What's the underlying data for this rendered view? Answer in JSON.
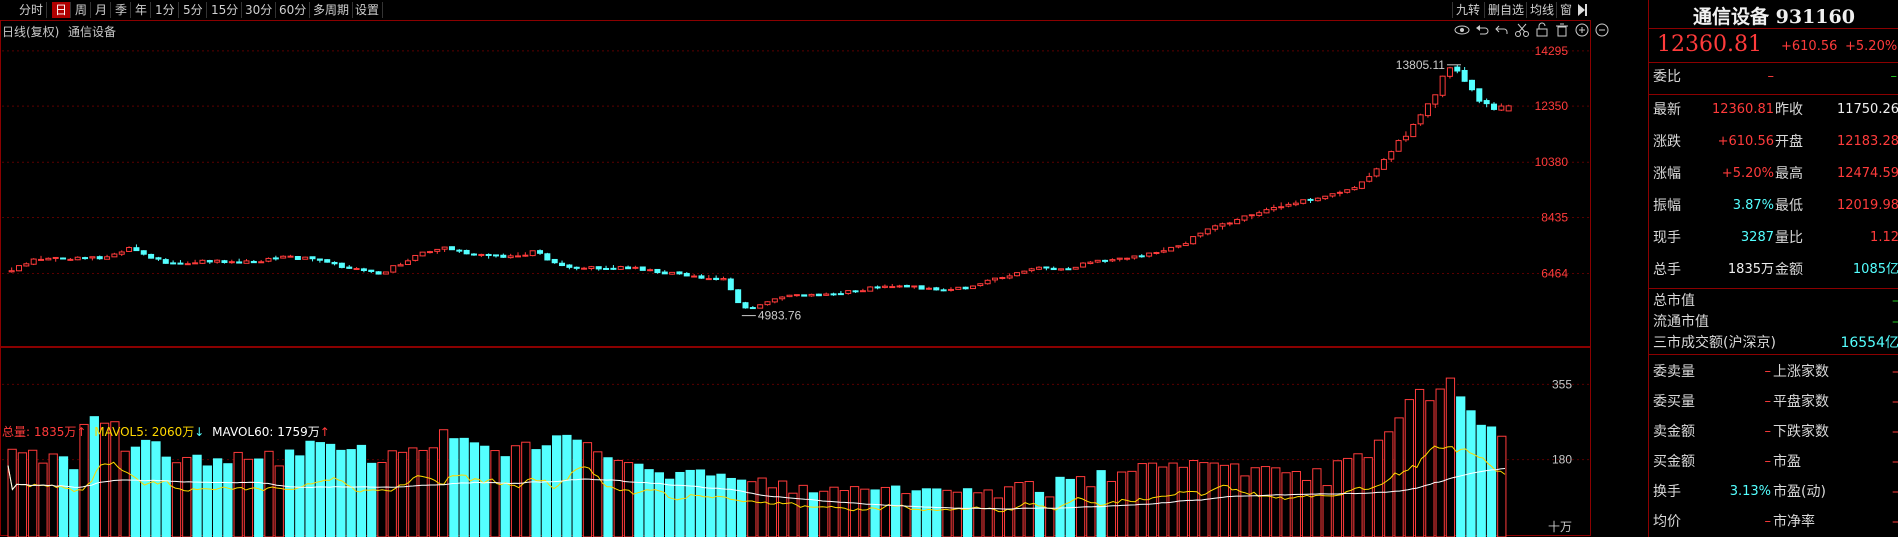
{
  "toolbar": {
    "items": [
      "分时",
      "日",
      "周",
      "月",
      "季",
      "年",
      "1分",
      "5分",
      "15分",
      "30分",
      "60分",
      "多周期",
      "设置"
    ],
    "active": "日",
    "right_items": [
      "九转",
      "删自选",
      "均线",
      "窗"
    ]
  },
  "chart": {
    "period_label": "日线(复权)",
    "name": "通信设备",
    "price_ticks": [
      "14295",
      "12350",
      "10380",
      "8435",
      "6464"
    ],
    "volume_ticks": [
      "355",
      "180"
    ],
    "volume_unit": "十万",
    "max_label": "13805.11",
    "min_label": "4983.76",
    "vol_info": {
      "total_label": "总量: 1835万",
      "total_arrow": "↑",
      "ma5_label": "MAVOL5: 2060万",
      "ma5_arrow": "↓",
      "ma60_label": "MAVOL60: 1759万",
      "ma60_arrow": "↑"
    },
    "colors": {
      "up": "#ff3b3b",
      "down": "#54ffff",
      "ma5": "#ffd800",
      "ma60": "#ffffff",
      "grid": "#5a0000"
    }
  },
  "chart_data": {
    "type": "candlestick",
    "title": "通信设备",
    "ylim": [
      4983.76,
      13805.11
    ],
    "high": 13805.11,
    "low": 4983.76,
    "last_close": 12360.81,
    "volume_ylim": [
      0,
      355
    ],
    "anchors_close": [
      [
        0,
        6520
      ],
      [
        20,
        7000
      ],
      [
        40,
        6960
      ],
      [
        60,
        7000
      ],
      [
        75,
        7150
      ],
      [
        85,
        7450
      ],
      [
        92,
        7160
      ],
      [
        110,
        6850
      ],
      [
        140,
        6880
      ],
      [
        170,
        6900
      ],
      [
        190,
        7080
      ],
      [
        210,
        6950
      ],
      [
        230,
        6700
      ],
      [
        255,
        6440
      ],
      [
        280,
        7120
      ],
      [
        300,
        7360
      ],
      [
        320,
        7080
      ],
      [
        345,
        7100
      ],
      [
        360,
        7220
      ],
      [
        385,
        6620
      ],
      [
        420,
        6700
      ],
      [
        470,
        6370
      ],
      [
        490,
        6280
      ],
      [
        500,
        5300
      ],
      [
        510,
        5240
      ],
      [
        530,
        5660
      ],
      [
        560,
        5740
      ],
      [
        575,
        5820
      ],
      [
        600,
        6060
      ],
      [
        640,
        5900
      ],
      [
        655,
        5960
      ],
      [
        680,
        6340
      ],
      [
        700,
        6640
      ],
      [
        720,
        6620
      ],
      [
        740,
        6860
      ],
      [
        770,
        7050
      ],
      [
        800,
        7440
      ],
      [
        820,
        8020
      ],
      [
        840,
        8360
      ],
      [
        855,
        8640
      ],
      [
        870,
        8900
      ],
      [
        900,
        9130
      ],
      [
        920,
        9520
      ],
      [
        940,
        10470
      ],
      [
        960,
        11780
      ],
      [
        970,
        12420
      ],
      [
        980,
        13500
      ],
      [
        990,
        13700
      ],
      [
        1000,
        12780
      ],
      [
        1010,
        12310
      ],
      [
        1020,
        12360
      ]
    ],
    "volume_anchors": [
      [
        0,
        150
      ],
      [
        40,
        140
      ],
      [
        60,
        215
      ],
      [
        80,
        175
      ],
      [
        100,
        160
      ],
      [
        140,
        130
      ],
      [
        200,
        165
      ],
      [
        260,
        145
      ],
      [
        300,
        180
      ],
      [
        340,
        148
      ],
      [
        380,
        175
      ],
      [
        400,
        150
      ],
      [
        420,
        125
      ],
      [
        480,
        110
      ],
      [
        520,
        95
      ],
      [
        560,
        90
      ],
      [
        600,
        85
      ],
      [
        640,
        80
      ],
      [
        680,
        88
      ],
      [
        720,
        100
      ],
      [
        760,
        120
      ],
      [
        800,
        130
      ],
      [
        850,
        120
      ],
      [
        880,
        115
      ],
      [
        900,
        125
      ],
      [
        930,
        150
      ],
      [
        950,
        210
      ],
      [
        970,
        280
      ],
      [
        985,
        270
      ],
      [
        1000,
        220
      ],
      [
        1020,
        183
      ]
    ],
    "ma5_last": 2060,
    "ma60_last": 1759
  },
  "quote": {
    "title": "通信设备 931160",
    "price": "12360.81",
    "change": "+610.56",
    "change_pct": "+5.20%",
    "weibi_label": "委比",
    "weibi_value": "–",
    "weibi_value2": "–",
    "rows": [
      {
        "l1": "最新",
        "v1": "12360.81",
        "c1": "red",
        "l2": "昨收",
        "v2": "11750.26",
        "c2": "white"
      },
      {
        "l1": "涨跌",
        "v1": "+610.56",
        "c1": "red",
        "l2": "开盘",
        "v2": "12183.28",
        "c2": "red"
      },
      {
        "l1": "涨幅",
        "v1": "+5.20%",
        "c1": "red",
        "l2": "最高",
        "v2": "12474.59",
        "c2": "red"
      },
      {
        "l1": "振幅",
        "v1": "3.87%",
        "c1": "cyan",
        "l2": "最低",
        "v2": "12019.98",
        "c2": "red"
      },
      {
        "l1": "现手",
        "v1": "3287",
        "c1": "cyan",
        "l2": "量比",
        "v2": "1.12",
        "c2": "red"
      },
      {
        "l1": "总手",
        "v1": "1835万",
        "c1": "white",
        "l2": "金额",
        "v2": "1085亿",
        "c2": "cyan"
      }
    ],
    "mkt_rows": [
      {
        "l": "总市值",
        "v": "–"
      },
      {
        "l": "流通市值",
        "v": "–"
      },
      {
        "l": "三市成交额(沪深京)",
        "v": "16554亿"
      }
    ],
    "bottom_rows": [
      {
        "l1": "委卖量",
        "v1": "–",
        "l2": "上涨家数",
        "v2": "–"
      },
      {
        "l1": "委买量",
        "v1": "–",
        "l2": "平盘家数",
        "v2": "–"
      },
      {
        "l1": "卖金额",
        "v1": "–",
        "l2": "下跌家数",
        "v2": "–"
      },
      {
        "l1": "买金额",
        "v1": "–",
        "l2": "市盈",
        "v2": "–"
      },
      {
        "l1": "换手",
        "v1": "3.13%",
        "l2": "市盈(动)",
        "v2": "–"
      },
      {
        "l1": "均价",
        "v1": "–",
        "l2": "市净率",
        "v2": "–"
      }
    ]
  }
}
